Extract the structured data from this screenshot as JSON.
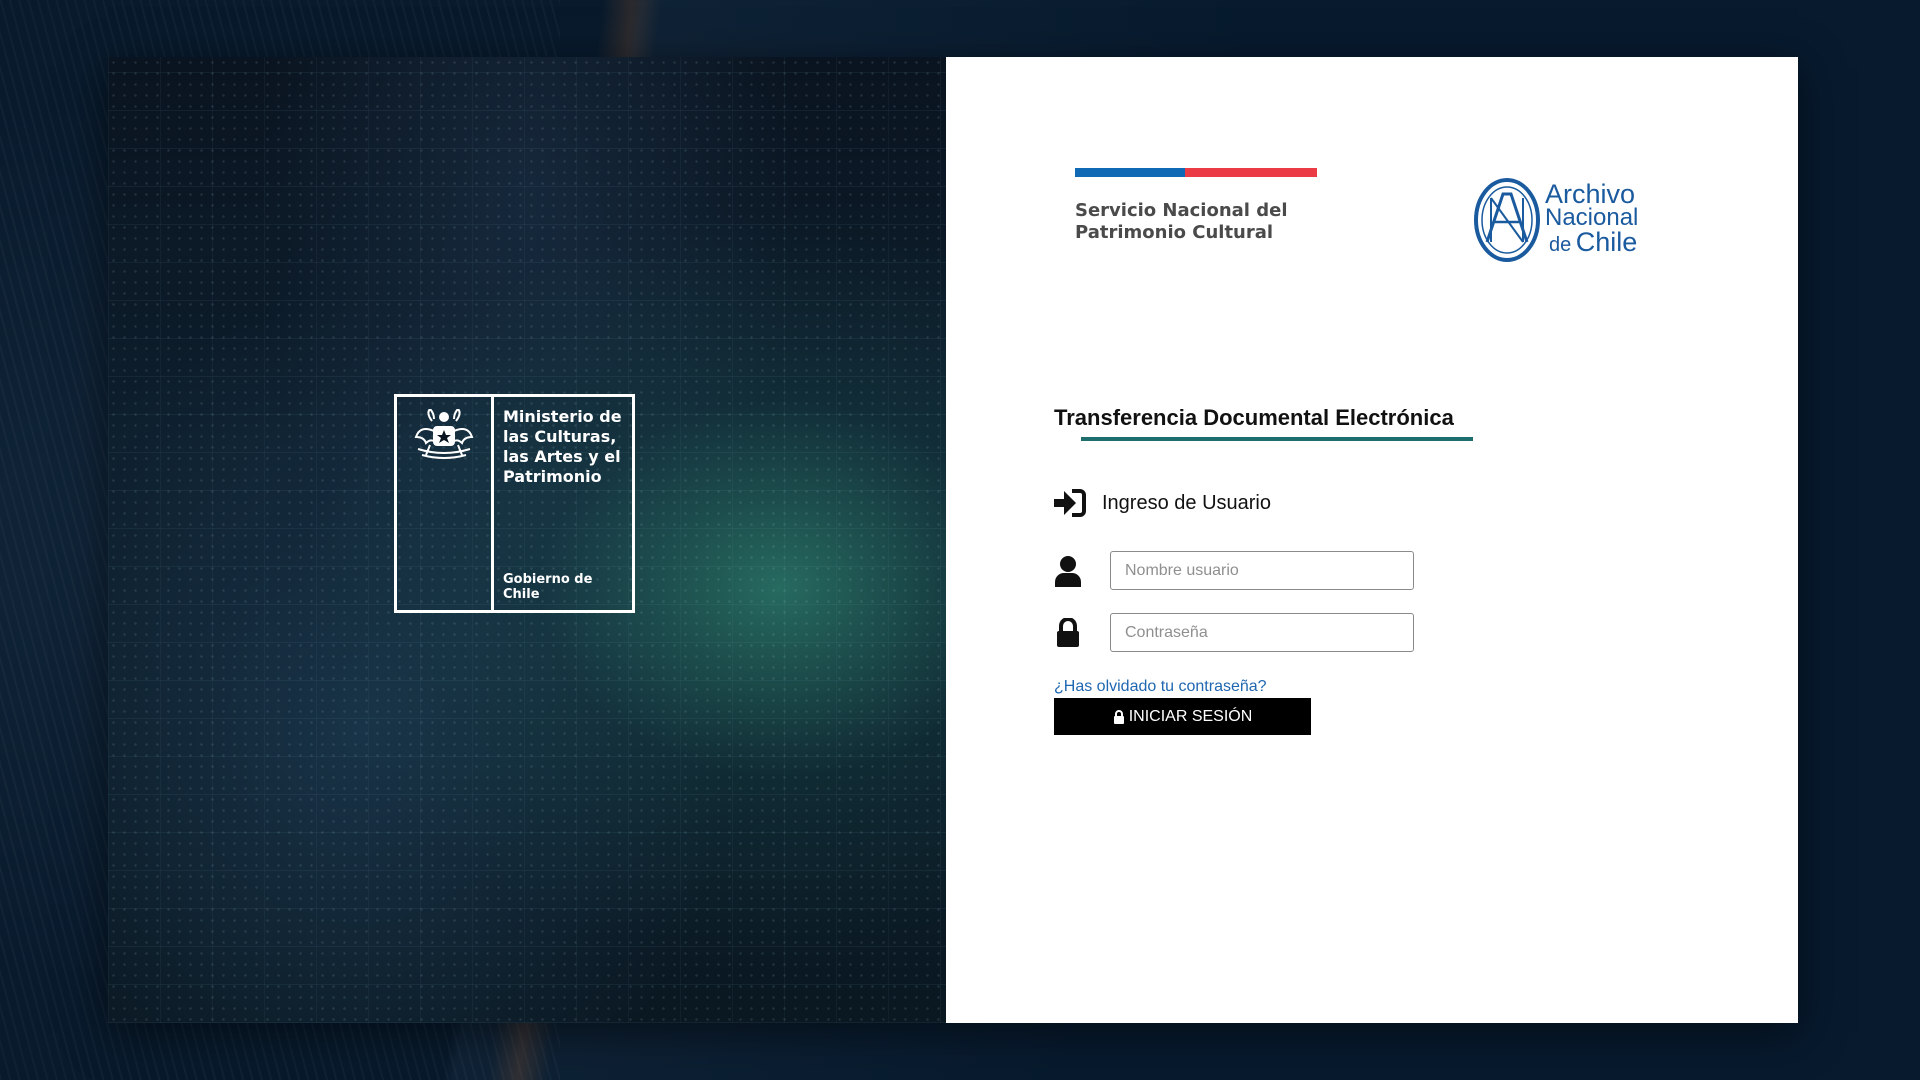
{
  "left_panel": {
    "ministry_logo": {
      "name": "Ministerio de\nlas Culturas,\nlas Artes y el\nPatrimonio",
      "government": "Gobierno de Chile",
      "emblem": "chile-coat-of-arms-icon"
    }
  },
  "header": {
    "snpc_logo": {
      "text": "Servicio Nacional del\nPatrimonio Cultural",
      "flag_colors": [
        "#0f69b4",
        "#eb3c46"
      ]
    },
    "anc_logo": {
      "line1": "Archivo",
      "line2": "Nacional",
      "line3_small": "de",
      "line3": "Chile",
      "color": "#1a5a9e",
      "emblem": "archivo-nacional-emblem-icon"
    }
  },
  "main": {
    "app_title": "Transferencia Documental Electrónica",
    "accent_color": "#1f6e6e",
    "login_heading": {
      "icon": "sign-in-icon",
      "label": "Ingreso de Usuario"
    },
    "username": {
      "icon": "user-icon",
      "placeholder": "Nombre usuario",
      "value": ""
    },
    "password": {
      "icon": "lock-icon",
      "placeholder": "Contraseña",
      "value": ""
    },
    "forgot_password_label": "¿Has olvidado tu contraseña?",
    "login_button": {
      "icon": "lock-icon",
      "label": "INICIAR SESIÓN"
    }
  }
}
